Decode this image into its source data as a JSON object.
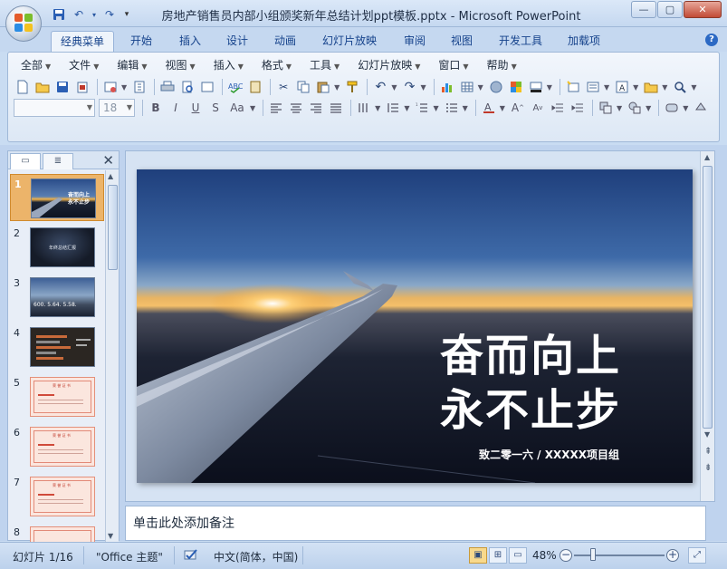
{
  "window": {
    "title": "房地产销售员内部小组颁奖新年总结计划ppt模板.pptx - Microsoft PowerPoint",
    "controls": [
      "—",
      "▢",
      "✕"
    ]
  },
  "quick_access": {
    "icons": [
      "save-icon",
      "undo-icon",
      "redo-icon",
      "customize-icon"
    ],
    "dropdown_glyph": "▾"
  },
  "tabs": [
    {
      "label": "经典菜单",
      "active": true
    },
    {
      "label": "开始"
    },
    {
      "label": "插入"
    },
    {
      "label": "设计"
    },
    {
      "label": "动画"
    },
    {
      "label": "幻灯片放映"
    },
    {
      "label": "审阅"
    },
    {
      "label": "视图"
    },
    {
      "label": "开发工具"
    },
    {
      "label": "加载项"
    }
  ],
  "help_label": "?",
  "menu": [
    "全部",
    "文件",
    "编辑",
    "视图",
    "插入",
    "格式",
    "工具",
    "幻灯片放映",
    "窗口",
    "帮助"
  ],
  "format_bar": {
    "font_name": "",
    "font_size": "18",
    "bold": "B",
    "italic": "I",
    "underline": "U",
    "shadow": "S",
    "case": "Aa"
  },
  "panel": {
    "tab_outline": "▭",
    "tab_slides": "≣",
    "close": "✕",
    "thumbnails": [
      {
        "num": "1",
        "caption": "奋而向上 永不止步",
        "selected": true
      },
      {
        "num": "2",
        "caption": "年终总结汇报"
      },
      {
        "num": "3",
        "caption": "600.  5.64.  5.58."
      },
      {
        "num": "4",
        "caption": ""
      },
      {
        "num": "5",
        "caption": "荣 誉 证 书"
      },
      {
        "num": "6",
        "caption": "荣 誉 证 书"
      },
      {
        "num": "7",
        "caption": "荣 誉 证 书"
      },
      {
        "num": "8",
        "caption": ""
      }
    ]
  },
  "slide": {
    "title_line1": "奋而向上",
    "title_line2": "永不止步",
    "subtitle": "致二零一六 / XXXXX项目组"
  },
  "notes_placeholder": "单击此处添加备注",
  "status": {
    "slide_counter": "幻灯片 1/16",
    "theme": "\"Office 主题\"",
    "language": "中文(简体，中国)",
    "zoom": "48%",
    "zoom_value": 48
  }
}
